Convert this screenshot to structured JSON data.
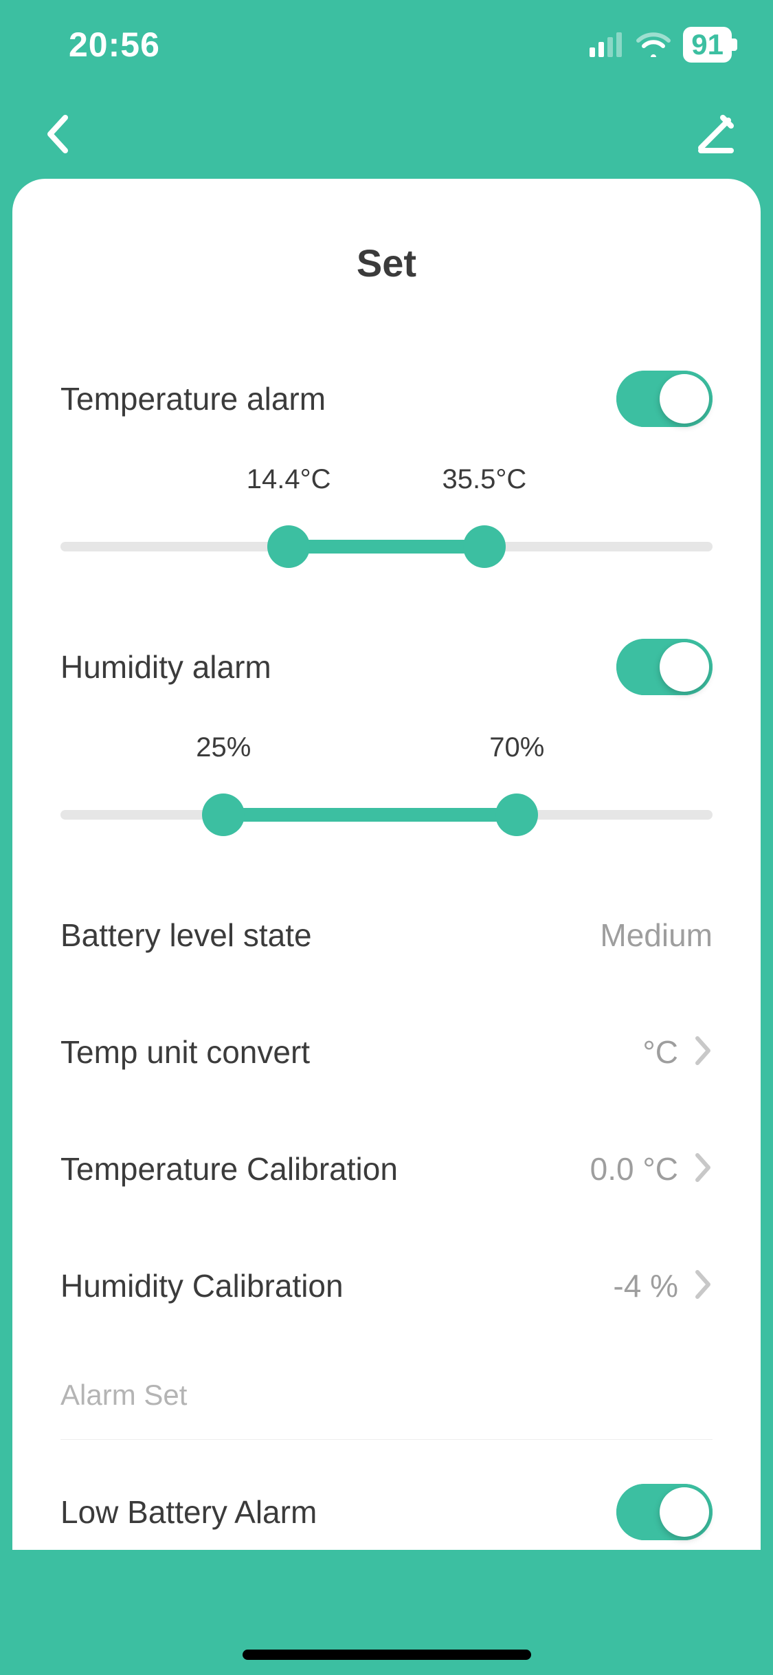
{
  "status": {
    "time": "20:56",
    "battery": "91"
  },
  "title": "Set",
  "tempAlarm": {
    "label": "Temperature alarm",
    "enabled": true,
    "lowLabel": "14.4°C",
    "highLabel": "35.5°C",
    "lowPct": 35,
    "highPct": 65
  },
  "humAlarm": {
    "label": "Humidity alarm",
    "enabled": true,
    "lowLabel": "25%",
    "highLabel": "70%",
    "lowPct": 25,
    "highPct": 70
  },
  "rows": {
    "battery": {
      "label": "Battery level state",
      "value": "Medium"
    },
    "tempUnit": {
      "label": "Temp unit convert",
      "value": "°C"
    },
    "tempCal": {
      "label": "Temperature Calibration",
      "value": "0.0 °C"
    },
    "humCal": {
      "label": "Humidity Calibration",
      "value": "-4 %"
    }
  },
  "alarmSection": "Alarm Set",
  "lowBattery": {
    "label": "Low Battery Alarm",
    "enabled": true
  }
}
